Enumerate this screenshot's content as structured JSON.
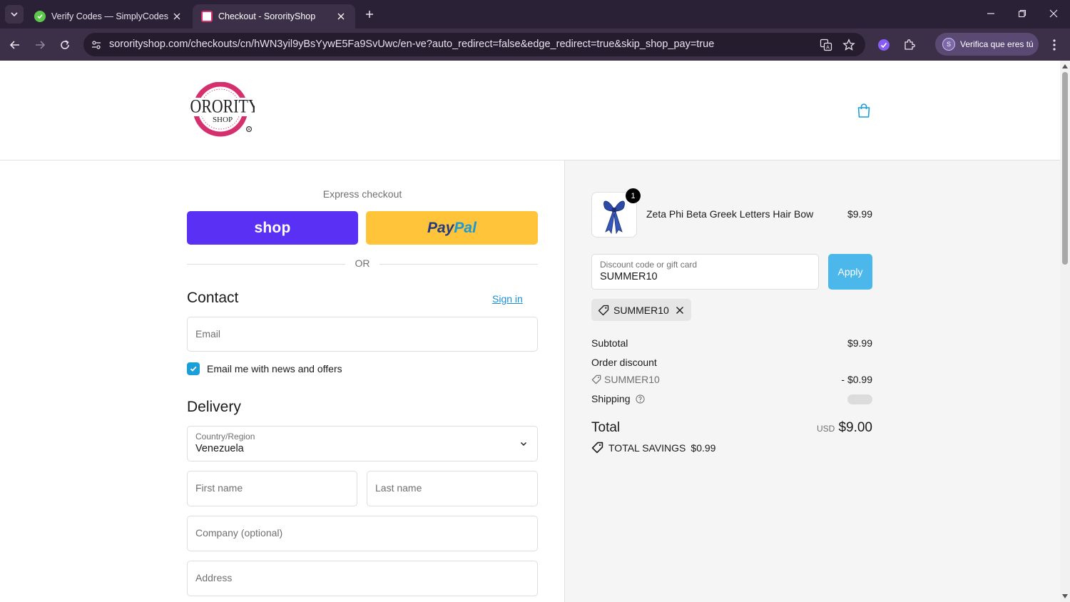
{
  "browser": {
    "tabs": [
      {
        "title": "Verify Codes — SimplyCodes",
        "active": false
      },
      {
        "title": "Checkout - SororityShop",
        "active": true
      }
    ],
    "url": "sororityshop.com/checkouts/cn/hWN3yil9yBsYywE5Fa9SvUwc/en-ve?auto_redirect=false&edge_redirect=true&skip_shop_pay=true",
    "profile_label": "Verifica que eres tú",
    "profile_initial": "S"
  },
  "header": {
    "logo_text": "SORORITY SHOP",
    "cart_icon": "shopping-bag-icon"
  },
  "express": {
    "title": "Express checkout",
    "shop_label": "shop",
    "paypal_part1": "Pay",
    "paypal_part2": "Pal",
    "or_label": "OR"
  },
  "contact": {
    "heading": "Contact",
    "sign_in": "Sign in",
    "email_placeholder": "Email",
    "newsletter_label": "Email me with news and offers",
    "newsletter_checked": true
  },
  "delivery": {
    "heading": "Delivery",
    "country_label": "Country/Region",
    "country_value": "Venezuela",
    "first_name_placeholder": "First name",
    "last_name_placeholder": "Last name",
    "company_placeholder": "Company (optional)",
    "address_placeholder": "Address"
  },
  "summary": {
    "item": {
      "name": "Zeta Phi Beta Greek Letters Hair Bow",
      "price": "$9.99",
      "quantity": "1"
    },
    "discount": {
      "label": "Discount code or gift card",
      "value": "SUMMER10",
      "apply_label": "Apply",
      "applied_code": "SUMMER10"
    },
    "subtotal_label": "Subtotal",
    "subtotal_value": "$9.99",
    "order_discount_label": "Order discount",
    "order_discount_code": "SUMMER10",
    "order_discount_value": "- $0.99",
    "shipping_label": "Shipping",
    "total_label": "Total",
    "total_currency": "USD",
    "total_value": "$9.00",
    "savings_label": "TOTAL SAVINGS",
    "savings_value": "$0.99"
  },
  "colors": {
    "shop_pay": "#5a31f4",
    "paypal": "#ffc439",
    "accent": "#1a9fd8",
    "apply": "#4bb7ea"
  }
}
